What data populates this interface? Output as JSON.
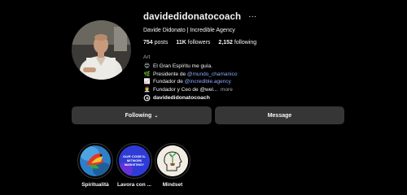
{
  "profile": {
    "username": "davidedidonatocoach",
    "more_icon": "ellipsis-icon",
    "full_name": "Davide Didonato | Incredible Agency",
    "stats": {
      "posts": {
        "count": "754",
        "label": "posts"
      },
      "followers": {
        "count": "11K",
        "label": "followers"
      },
      "following": {
        "count": "2,152",
        "label": "following"
      }
    },
    "category": "Art",
    "bio": {
      "line1": {
        "emoji": "😊",
        "text": "El Gran Espíritu me guía."
      },
      "line2": {
        "emoji": "🌿",
        "prefix": "Presidente de ",
        "link": "@mundo_chamanico"
      },
      "line3": {
        "emoji": "📈",
        "prefix": "Fundador de ",
        "link": "@incredible.agency"
      },
      "line4": {
        "emoji": "👨‍💼",
        "prefix": "Fundador y Ceo de @wel... ",
        "more": "more"
      }
    },
    "threads_handle": "davidedidonatocoach"
  },
  "actions": {
    "following_label": "Following",
    "message_label": "Message"
  },
  "highlights": [
    {
      "label": "Spiritualità"
    },
    {
      "label": "Lavora con ...",
      "cover_text": "OUR COSE IL NETWORK MARKETING?"
    },
    {
      "label": "Mindset"
    }
  ],
  "colors": {
    "background": "#000000",
    "button": "#363636",
    "link": "#8da9ff",
    "secondary_text": "#a8a8a8",
    "highlight2_bg": "#2f3bd6"
  }
}
